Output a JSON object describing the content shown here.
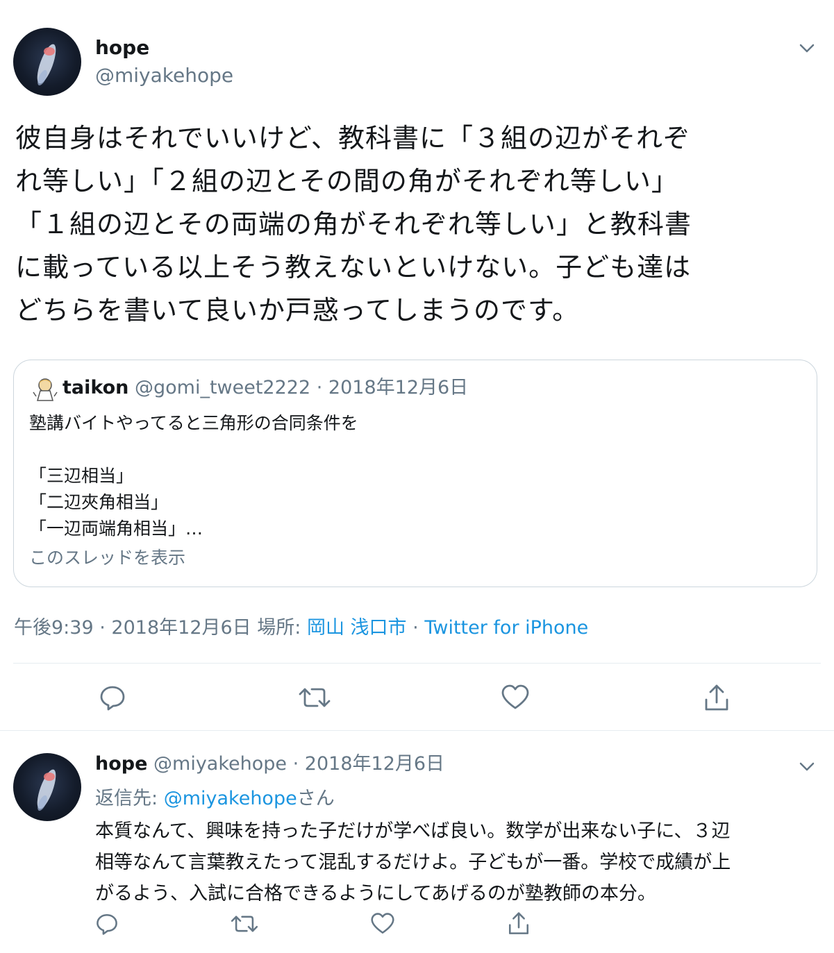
{
  "tweet": {
    "display_name": "hope",
    "handle": "@miyakehope",
    "text_lines": [
      "彼自身はそれでいいけど、教科書に「３組の辺がそれぞ",
      "れ等しい」「２組の辺とその間の角がそれぞれ等しい」",
      "「１組の辺とその両端の角がそれぞれ等しい」と教科書",
      "に載っている以上そう教えないといけない。子ども達は",
      "どちらを書いて良いか戸惑ってしまうのです。"
    ],
    "quote": {
      "display_name": "taikon",
      "handle": "@gomi_tweet2222",
      "separator": "·",
      "date": "2018年12月6日",
      "body_lines": [
        "塾講バイトやってると三角形の合同条件を",
        "",
        "「三辺相当」",
        "「二辺夾角相当」",
        "「一辺両端角相当」…"
      ],
      "show_thread": "このスレッドを表示"
    },
    "meta": {
      "time": "午後9:39",
      "sep1": "·",
      "date": "2018年12月6日",
      "place_label": "場所:",
      "place": "岡山 浅口市",
      "sep2": "·",
      "source": "Twitter for iPhone"
    }
  },
  "reply": {
    "display_name": "hope",
    "handle": "@miyakehope",
    "separator": "·",
    "date": "2018年12月6日",
    "reply_to_label": "返信先:",
    "reply_to_handle": "@miyakehope",
    "reply_to_suffix": "さん",
    "text_lines": [
      "本質なんて、興味を持った子だけが学べば良い。数学が出来ない子に、３辺",
      "相等なんて言葉教えたって混乱するだけよ。子どもが一番。学校で成績が上",
      "がるよう、入試に合格できるようにしてあげるのが塾教師の本分。"
    ]
  },
  "icons": [
    "chevron-down-icon",
    "reply-icon",
    "retweet-icon",
    "like-icon",
    "share-icon"
  ],
  "colors": {
    "text": "#14171a",
    "muted": "#657786",
    "link": "#1b95e0",
    "border": "#ccd6dd",
    "divider": "#e6ecf0"
  }
}
